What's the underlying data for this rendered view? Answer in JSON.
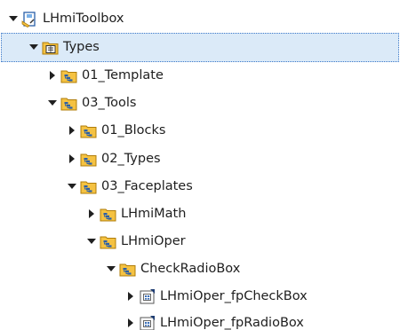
{
  "tree": {
    "items": [
      {
        "label": "LHmiToolbox",
        "expanded": true,
        "icon": "library-icon",
        "level": 0
      },
      {
        "label": "Types",
        "expanded": true,
        "icon": "types-folder-icon",
        "level": 1,
        "selected": true
      },
      {
        "label": "01_Template",
        "expanded": false,
        "icon": "group-folder-icon",
        "level": 2
      },
      {
        "label": "03_Tools",
        "expanded": true,
        "icon": "group-folder-icon",
        "level": 2
      },
      {
        "label": "01_Blocks",
        "expanded": false,
        "icon": "group-folder-icon",
        "level": 3
      },
      {
        "label": "02_Types",
        "expanded": false,
        "icon": "group-folder-icon",
        "level": 3
      },
      {
        "label": "03_Faceplates",
        "expanded": true,
        "icon": "group-folder-icon",
        "level": 3
      },
      {
        "label": "LHmiMath",
        "expanded": false,
        "icon": "group-folder-icon",
        "level": 4
      },
      {
        "label": "LHmiOper",
        "expanded": true,
        "icon": "group-folder-icon",
        "level": 4
      },
      {
        "label": "CheckRadioBox",
        "expanded": true,
        "icon": "group-folder-icon",
        "level": 5
      },
      {
        "label": "LHmiOper_fpCheckBox",
        "expanded": false,
        "icon": "faceplate-type-icon",
        "level": 6
      },
      {
        "label": "LHmiOper_fpRadioBox",
        "expanded": false,
        "icon": "faceplate-type-icon",
        "level": 6
      }
    ]
  },
  "colors": {
    "selection_bg": "#dbeaf8",
    "selection_border": "#3c78c8",
    "folder_fill": "#f5c242",
    "folder_stroke": "#b07d0a",
    "group_mark": "#2a5fa8",
    "arrow": "#202020"
  }
}
